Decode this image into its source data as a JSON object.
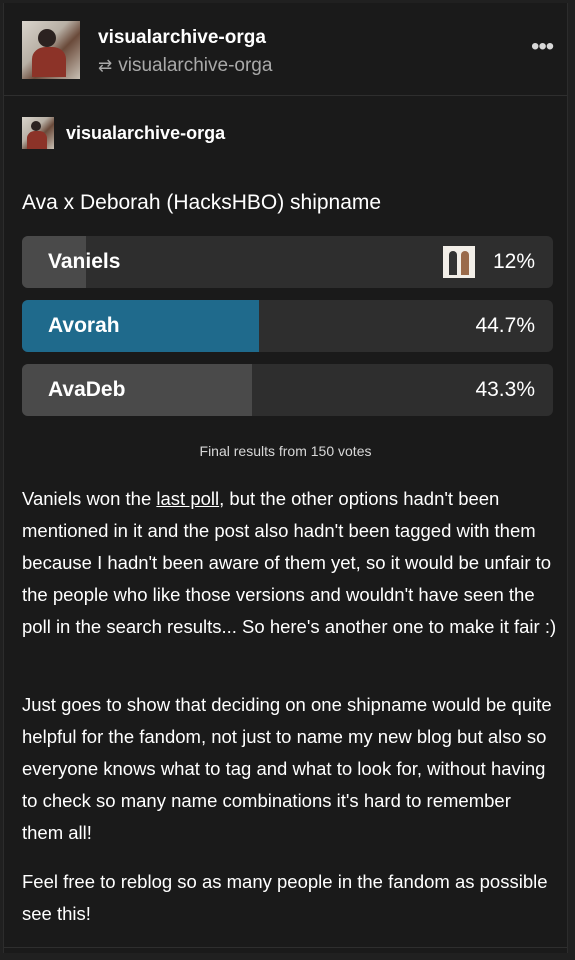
{
  "header": {
    "blog_name": "visualarchive-orga",
    "reblogged_from": "visualarchive-orga",
    "more_icon": "more-horizontal-icon",
    "reblog_icon": "reblog-icon"
  },
  "reblog": {
    "blog_name": "visualarchive-orga"
  },
  "poll": {
    "question": "Ava x Deborah (HacksHBO) shipname",
    "options": [
      {
        "label": "Vaniels",
        "percent_text": "12%",
        "percent": 12,
        "winner": false,
        "has_image": true
      },
      {
        "label": "Avorah",
        "percent_text": "44.7%",
        "percent": 44.7,
        "winner": true,
        "has_image": false
      },
      {
        "label": "AvaDeb",
        "percent_text": "43.3%",
        "percent": 43.3,
        "winner": false,
        "has_image": false
      }
    ],
    "footer": "Final results from 150 votes",
    "colors": {
      "winner_fill": "#1f6a8c",
      "fill": "#4a4a4a",
      "track": "#2e2e2e"
    }
  },
  "body": {
    "p1_before_link": "Vaniels won the ",
    "p1_link": "last poll",
    "p1_after_link": ", but the other options hadn't been mentioned in it and the post also hadn't been tagged with them because I hadn't been aware of them yet, so it would be unfair to the people who like those versions and wouldn't have seen the poll in the search results... So here's another one to make it fair :)",
    "p2": "Just goes to show that deciding on one shipname would be quite helpful for the fandom, not just to name my new blog but also so everyone knows what to tag and what to look for, without having to check so many name combinations it's hard to remember them all!",
    "p3": "Feel free to reblog so as many people in the fandom as possible see this!"
  }
}
